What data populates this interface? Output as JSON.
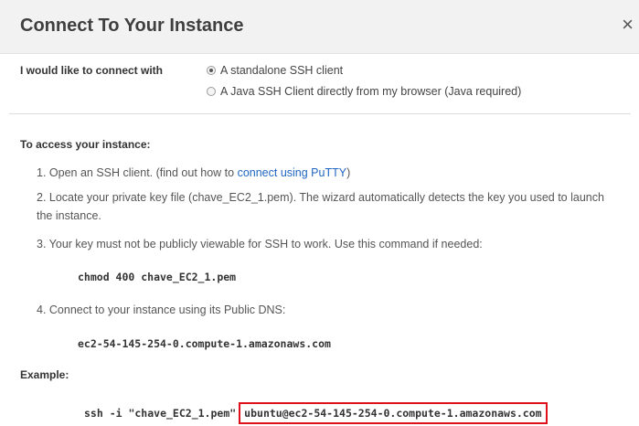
{
  "dialog": {
    "title": "Connect To Your Instance",
    "close_icon": "×"
  },
  "connect_with": {
    "label": "I would like to connect with",
    "options": [
      {
        "label": "A standalone SSH client",
        "checked": true
      },
      {
        "label": "A Java SSH Client directly from my browser (Java required)",
        "checked": false
      }
    ]
  },
  "access": {
    "heading": "To access your instance:",
    "step1_prefix": "1. Open an SSH client. (find out how to ",
    "step1_link": "connect using PuTTY",
    "step1_suffix": ")",
    "step2": "2. Locate your private key file (chave_EC2_1.pem). The wizard automatically detects the key you used to launch the instance.",
    "step3": "3. Your key must not be publicly viewable for SSH to work. Use this command if needed:",
    "chmod_command": "chmod 400 chave_EC2_1.pem",
    "step4": "4. Connect to your instance using its Public DNS:",
    "public_dns": "ec2-54-145-254-0.compute-1.amazonaws.com"
  },
  "example": {
    "heading": "Example:",
    "command_prefix": "ssh -i \"chave_EC2_1.pem\"",
    "command_target": "ubuntu@ec2-54-145-254-0.compute-1.amazonaws.com"
  },
  "colors": {
    "highlight_border": "#e0101b",
    "link": "#1f66c2"
  }
}
